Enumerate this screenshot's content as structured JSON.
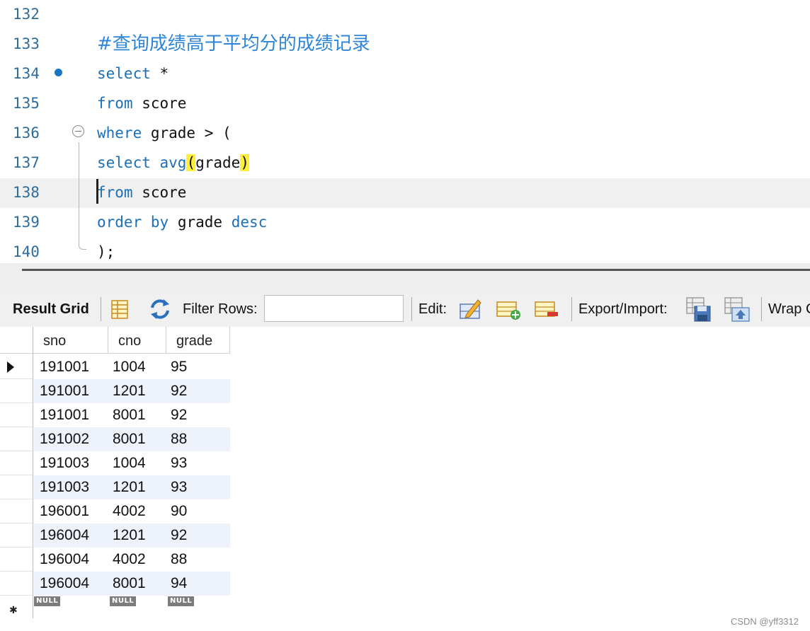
{
  "editor": {
    "lines": [
      {
        "number": "132",
        "parts": []
      },
      {
        "number": "133",
        "parts": [
          {
            "t": "#查询成绩高于平均分的成绩记录",
            "c": "comment"
          }
        ]
      },
      {
        "number": "134",
        "parts": [
          {
            "t": "select",
            "c": "kw"
          },
          {
            "t": " *",
            "c": "id"
          }
        ]
      },
      {
        "number": "135",
        "parts": [
          {
            "t": "from",
            "c": "kw"
          },
          {
            "t": " score",
            "c": "id"
          }
        ]
      },
      {
        "number": "136",
        "parts": [
          {
            "t": "where",
            "c": "kw"
          },
          {
            "t": " grade > (",
            "c": "id"
          }
        ]
      },
      {
        "number": "137",
        "parts": [
          {
            "t": "select",
            "c": "kw"
          },
          {
            "t": " ",
            "c": "id"
          },
          {
            "t": "avg",
            "c": "kw"
          },
          {
            "t": "(",
            "c": "id hl"
          },
          {
            "t": "grade",
            "c": "id"
          },
          {
            "t": ")",
            "c": "id hl"
          }
        ]
      },
      {
        "number": "138",
        "parts": [
          {
            "t": "from",
            "c": "kw"
          },
          {
            "t": " score",
            "c": "id"
          }
        ]
      },
      {
        "number": "139",
        "parts": [
          {
            "t": "order",
            "c": "kw"
          },
          {
            "t": " ",
            "c": "id"
          },
          {
            "t": "by",
            "c": "kw"
          },
          {
            "t": " grade ",
            "c": "id"
          },
          {
            "t": "desc",
            "c": "kw"
          }
        ]
      },
      {
        "number": "140",
        "parts": [
          {
            "t": ");",
            "c": "id"
          }
        ]
      }
    ]
  },
  "toolbar": {
    "result_grid": "Result Grid",
    "filter_rows": "Filter Rows:",
    "filter_value": "",
    "edit": "Edit:",
    "export_import": "Export/Import:",
    "wrap": "Wrap C"
  },
  "grid": {
    "columns": [
      "sno",
      "cno",
      "grade"
    ],
    "rows": [
      [
        "191001",
        "1004",
        "95"
      ],
      [
        "191001",
        "1201",
        "92"
      ],
      [
        "191001",
        "8001",
        "92"
      ],
      [
        "191002",
        "8001",
        "88"
      ],
      [
        "191003",
        "1004",
        "93"
      ],
      [
        "191003",
        "1201",
        "93"
      ],
      [
        "196001",
        "4002",
        "90"
      ],
      [
        "196004",
        "1201",
        "92"
      ],
      [
        "196004",
        "4002",
        "88"
      ],
      [
        "196004",
        "8001",
        "94"
      ]
    ],
    "null_label": "NULL",
    "new_row_marker": "✱"
  },
  "watermark": "CSDN @yff3312",
  "colors": {
    "keyword": "#1a6fb8",
    "comment": "#2f86d8",
    "line_number": "#2e6c9c",
    "bracket_highlight": "#ffee3a",
    "alt_row": "#eef3fb"
  }
}
